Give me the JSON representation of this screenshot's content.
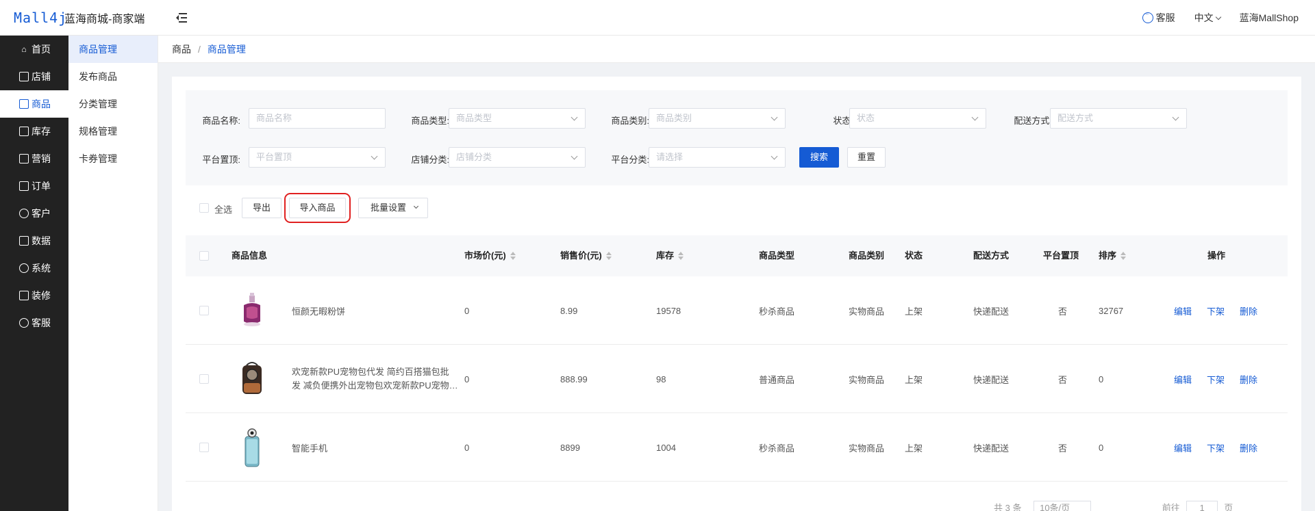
{
  "header": {
    "logo": "Mall4j",
    "title": "蓝海商城-商家端",
    "service": "客服",
    "language": "中文",
    "shop": "蓝海MallShop"
  },
  "sidebar": {
    "items": [
      {
        "label": "首页",
        "icon": "home-icon"
      },
      {
        "label": "店铺",
        "icon": "shop-icon"
      },
      {
        "label": "商品",
        "icon": "product-icon"
      },
      {
        "label": "库存",
        "icon": "stock-icon"
      },
      {
        "label": "营销",
        "icon": "gift-icon"
      },
      {
        "label": "订单",
        "icon": "order-icon"
      },
      {
        "label": "客户",
        "icon": "users-icon"
      },
      {
        "label": "数据",
        "icon": "data-icon"
      },
      {
        "label": "系统",
        "icon": "settings-icon"
      },
      {
        "label": "装修",
        "icon": "decorate-icon"
      },
      {
        "label": "客服",
        "icon": "chat-icon"
      }
    ]
  },
  "submenu": {
    "items": [
      "商品管理",
      "发布商品",
      "分类管理",
      "规格管理",
      "卡券管理"
    ]
  },
  "breadcrumb": {
    "root": "商品",
    "sep": "/",
    "current": "商品管理"
  },
  "filter": {
    "name_label": "商品名称:",
    "name_placeholder": "商品名称",
    "type_label": "商品类型:",
    "type_placeholder": "商品类型",
    "category_label": "商品类别:",
    "category_placeholder": "商品类别",
    "status_label": "状态:",
    "status_placeholder": "状态",
    "delivery_label": "配送方式:",
    "delivery_placeholder": "配送方式",
    "top_label": "平台置顶:",
    "top_placeholder": "平台置顶",
    "shop_cat_label": "店铺分类:",
    "shop_cat_placeholder": "店铺分类",
    "platform_cat_label": "平台分类:",
    "platform_cat_placeholder": "请选择",
    "search_btn": "搜索",
    "reset_btn": "重置"
  },
  "toolbar": {
    "select_all": "全选",
    "export": "导出",
    "import": "导入商品",
    "batch": "批量设置"
  },
  "table": {
    "columns": [
      "商品信息",
      "市场价(元)",
      "销售价(元)",
      "库存",
      "商品类型",
      "商品类别",
      "状态",
      "配送方式",
      "平台置顶",
      "排序",
      "操作"
    ],
    "rows": [
      {
        "name_1": "恒颜无暇粉饼",
        "name_2": "",
        "market": "0",
        "price": "8.99",
        "stock": "19578",
        "type": "秒杀商品",
        "category": "实物商品",
        "status": "上架",
        "delivery": "快递配送",
        "top": "否",
        "sort": "32767"
      },
      {
        "name_1": "欢宠新款PU宠物包代发 简约百搭猫包批",
        "name_2": "发 减负便携外出宠物包欢宠新款PU宠物包代发",
        "market": "0",
        "price": "888.99",
        "stock": "98",
        "type": "普通商品",
        "category": "实物商品",
        "status": "上架",
        "delivery": "快递配送",
        "top": "否",
        "sort": "0"
      },
      {
        "name_1": "智能手机",
        "name_2": "",
        "market": "0",
        "price": "8899",
        "stock": "1004",
        "type": "秒杀商品",
        "category": "实物商品",
        "status": "上架",
        "delivery": "快递配送",
        "top": "否",
        "sort": "0"
      }
    ],
    "actions": {
      "edit": "编辑",
      "offline": "下架",
      "delete": "删除"
    }
  },
  "pager": {
    "total": "共 3 条",
    "size": "10条/页",
    "goto": "前往",
    "page": "1",
    "unit": "页"
  }
}
